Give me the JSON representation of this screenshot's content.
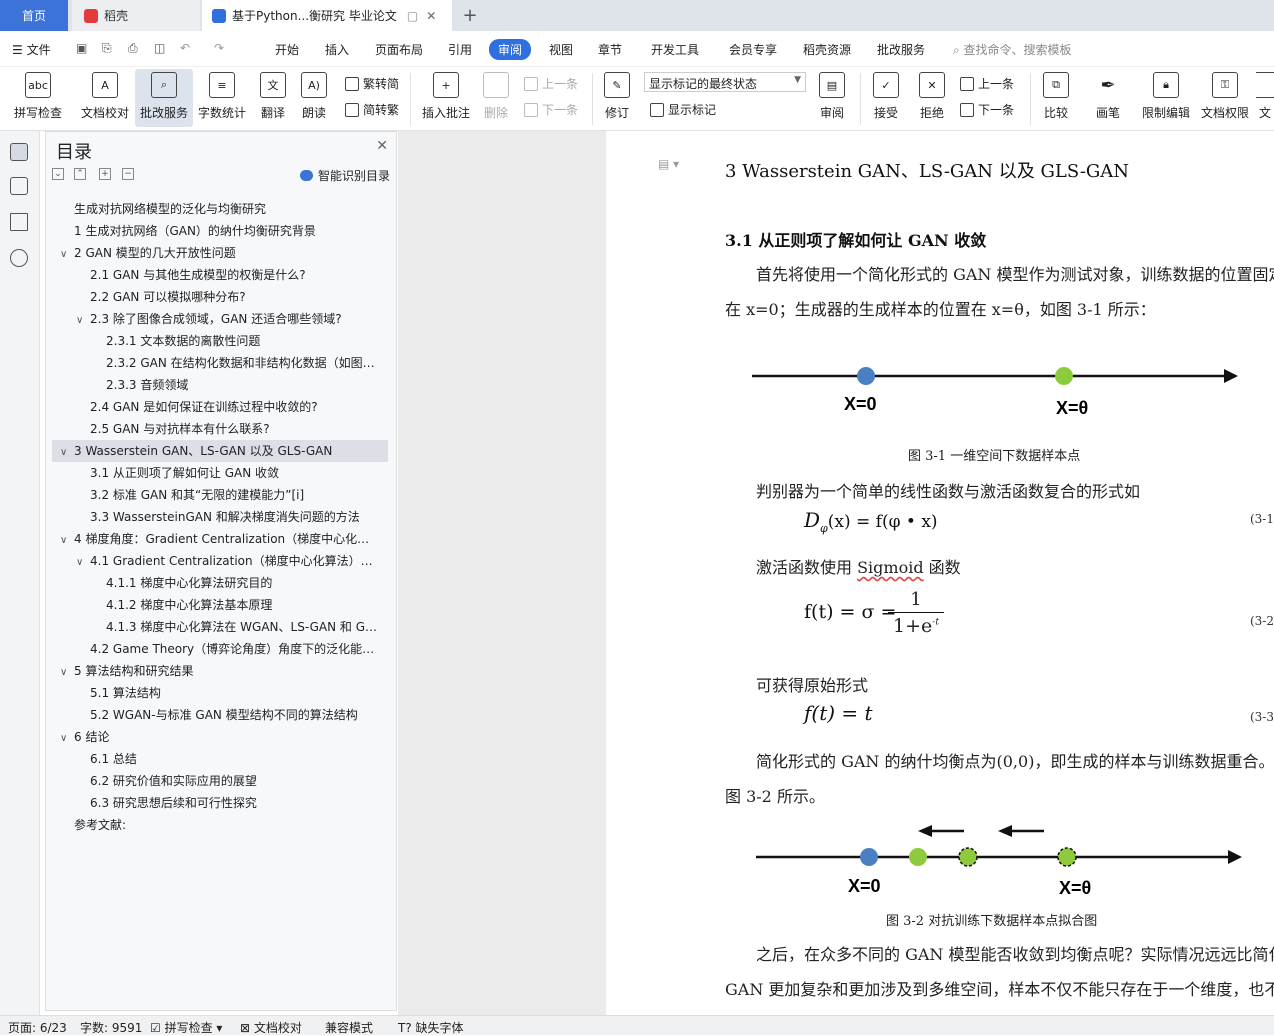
{
  "tabs": {
    "home": "首页",
    "daoke": "稻壳",
    "doc": "基于Python...衡研究 毕业论文",
    "plus": "+"
  },
  "menu": {
    "file": "文件",
    "items": [
      "开始",
      "插入",
      "页面布局",
      "引用",
      "审阅",
      "视图",
      "章节",
      "开发工具",
      "会员专享",
      "稻壳资源",
      "批改服务"
    ],
    "search": "查找命令、搜索模板"
  },
  "ribbon": {
    "spell": "拼写检查",
    "proof": "文档校对",
    "correct": "批改服务",
    "count": "字数统计",
    "translate": "翻译",
    "read": "朗读",
    "trad": "繁转简",
    "simp": "简转繁",
    "insert_comment": "插入批注",
    "delete": "删除",
    "prev": "上一条",
    "next": "下一条",
    "revise": "修订",
    "markup_select": "显示标记的最终状态",
    "show_markup": "显示标记",
    "review": "审阅",
    "accept": "接受",
    "reject": "拒绝",
    "prev2": "上一条",
    "next2": "下一条",
    "compare": "比较",
    "pen": "画笔",
    "restrict": "限制编辑",
    "rights": "文档权限",
    "more": "文"
  },
  "nav": {
    "title": "目录",
    "smart": "智能识别目录",
    "items": [
      {
        "t": "生成对抗网络模型的泛化与均衡研究",
        "c": ""
      },
      {
        "t": "1   生成对抗网络（GAN）的纳什均衡研究背景",
        "c": ""
      },
      {
        "t": "2   GAN 模型的几大开放性问题",
        "c": "∨"
      },
      {
        "t": "2.1   GAN 与其他生成模型的权衡是什么?",
        "c": ""
      },
      {
        "t": "2.2   GAN 可以模拟哪种分布?",
        "c": ""
      },
      {
        "t": "2.3   除了图像合成领域，GAN 还适合哪些领域?",
        "c": "∨"
      },
      {
        "t": "2.3.1   文本数据的离散性问题",
        "c": ""
      },
      {
        "t": "2.3.2   GAN 在结构化数据和非结构化数据（如图…",
        "c": ""
      },
      {
        "t": "2.3.3   音频领域",
        "c": ""
      },
      {
        "t": "2.4   GAN 是如何保证在训练过程中收敛的?",
        "c": ""
      },
      {
        "t": "2.5   GAN 与对抗样本有什么联系?",
        "c": ""
      },
      {
        "t": "3   Wasserstein GAN、LS-GAN 以及 GLS-GAN",
        "c": "∨"
      },
      {
        "t": "3.1   从正则项了解如何让 GAN 收敛",
        "c": ""
      },
      {
        "t": "3.2   标准 GAN 和其“无限的建模能力”[i]",
        "c": ""
      },
      {
        "t": "3.3   WassersteinGAN 和解决梯度消失问题的方法",
        "c": ""
      },
      {
        "t": "4   梯度角度：Gradient Centralization（梯度中心化…",
        "c": "∨"
      },
      {
        "t": "4.1   Gradient Centralization（梯度中心化算法）…",
        "c": "∨"
      },
      {
        "t": "4.1.1   梯度中心化算法研究目的",
        "c": ""
      },
      {
        "t": "4.1.2   梯度中心化算法基本原理",
        "c": ""
      },
      {
        "t": "4.1.3   梯度中心化算法在 WGAN、LS-GAN 和 G…",
        "c": ""
      },
      {
        "t": "4.2   Game Theory（博弈论角度）角度下的泛化能…",
        "c": ""
      },
      {
        "t": "5   算法结构和研究结果",
        "c": "∨"
      },
      {
        "t": "5.1   算法结构",
        "c": ""
      },
      {
        "t": "5.2   WGAN-与标准 GAN 模型结构不同的算法结构",
        "c": ""
      },
      {
        "t": "6   结论",
        "c": "∨"
      },
      {
        "t": "6.1   总结",
        "c": ""
      },
      {
        "t": "6.2   研究价值和实际应用的展望",
        "c": ""
      },
      {
        "t": "6.3   研究思想后续和可行性探究",
        "c": ""
      },
      {
        "t": "参考文献:",
        "c": ""
      }
    ]
  },
  "doc": {
    "h1": "3    Wasserstein GAN、LS-GAN 以及 GLS-GAN",
    "h2": "3.1    从正则项了解如何让 GAN 收敛",
    "p1a": "首先将使用一个简化形式的 GAN 模型作为测试对象，训练数据的位置固定",
    "p1b": "在 x=0；生成器的生成样本的位置在 x=θ，如图 3-1 所示：",
    "fig1_x0": "X=0",
    "fig1_xt": "X=θ",
    "cap1": "图 3-1    一维空间下数据样本点",
    "p2": "判别器为一个简单的线性函数与激活函数复合的形式如",
    "eq1": "D",
    "eq1_sub": "φ",
    "eq1_rest": "(x) = f(φ • x)",
    "eq1_no": "(3-1",
    "p3a": "激活函数使用 ",
    "p3b": "Sigmoid",
    "p3c": " 函数",
    "eq2_lhs": "f(t) = σ =",
    "eq2_num": "1",
    "eq2_den": "1+e",
    "eq2_exp": "-t",
    "eq2_no": "(3-2",
    "p4": "可获得原始形式",
    "eq3": "f(t) = t",
    "eq3_no": "(3-3",
    "p5a": "简化形式的 GAN 的纳什均衡点为(0,0)，即生成的样本与训练数据重合。如",
    "p5b": "图 3-2 所示。",
    "fig2_x0": "X=0",
    "fig2_xt": "X=θ",
    "cap2": "图 3-2    对抗训练下数据样本点拟合图",
    "p6a": "之后，在众多不同的 GAN 模型能否收敛到均衡点呢？实际情况远远比简化",
    "p6b": "GAN 更加复杂和更加涉及到多维空间，样本不仅不能只存在于一个维度，也不"
  },
  "status": {
    "page": "页面: 6/23",
    "words": "字数: 9591",
    "spell": "拼写检查",
    "proof": "文档校对",
    "compat": "兼容模式",
    "font": "缺失字体"
  },
  "colors": {
    "accent": "#2f6fdf",
    "blue_dot": "#4a7fc4",
    "green_dot": "#8dcb3c"
  }
}
